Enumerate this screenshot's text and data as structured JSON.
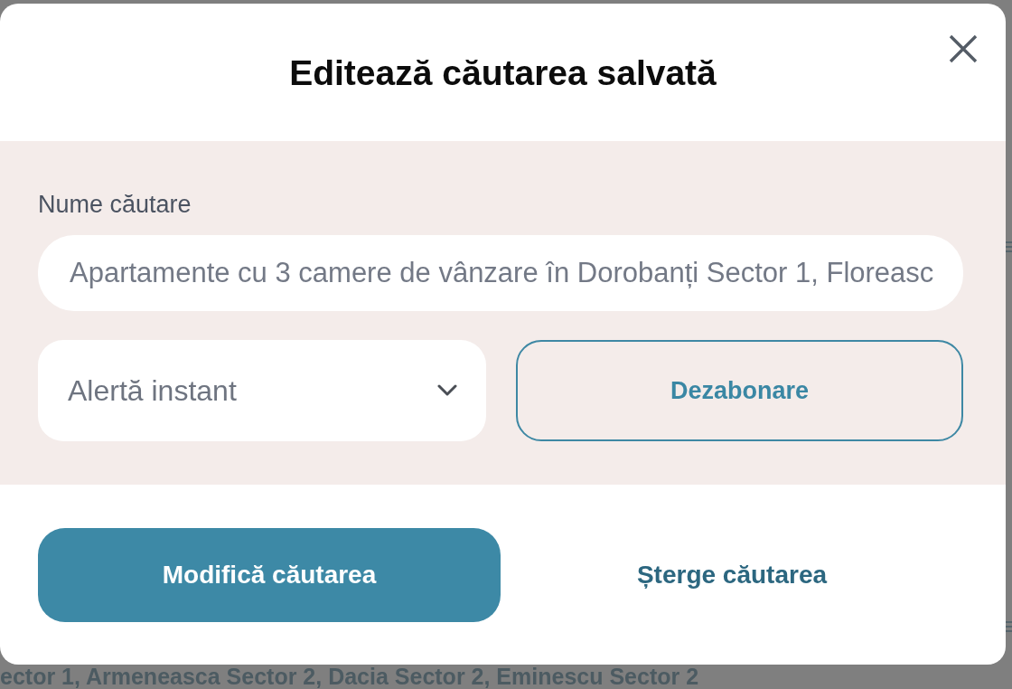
{
  "background": {
    "text": "ector 1, Armeneasca Sector 2, Dacia Sector 2, Eminescu Sector 2"
  },
  "dialog": {
    "title": "Editează căutarea salvată",
    "name_field": {
      "label": "Nume căutare",
      "value": "Apartamente cu 3 camere de vânzare în Dorobanți Sector 1, Floreasc"
    },
    "alert_select": {
      "value": "Alertă instant"
    },
    "unsubscribe_button": "Dezabonare",
    "buttons": [
      {
        "label": "Modifică căutarea",
        "kind": "primary"
      },
      {
        "label": "Șterge căutarea",
        "kind": "link"
      }
    ]
  }
}
